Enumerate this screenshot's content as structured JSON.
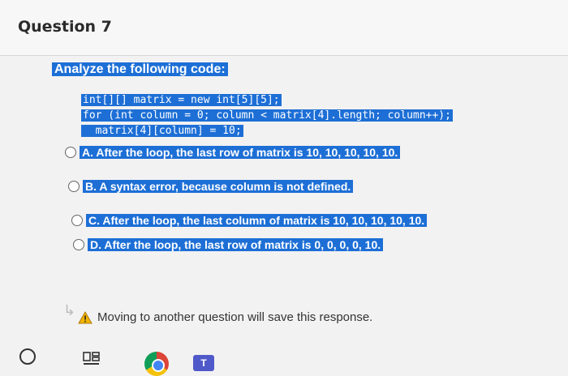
{
  "question": {
    "title": "Question 7"
  },
  "prompt": "Analyze the following code:",
  "code_lines": [
    "int[][] matrix = new int[5][5];",
    "for (int column = 0; column < matrix[4].length; column++);",
    "  matrix[4][column] = 10;"
  ],
  "options": [
    {
      "letter": "A.",
      "text": "After the loop, the last row of matrix is 10, 10, 10, 10, 10."
    },
    {
      "letter": "B.",
      "text": "A syntax error, because column is not defined."
    },
    {
      "letter": "C.",
      "text": "After the loop, the last column of matrix is 10, 10, 10, 10, 10."
    },
    {
      "letter": "D.",
      "text": "After the loop, the last row of matrix is 0, 0, 0, 0, 10."
    }
  ],
  "notice": "Moving to another question will save this response.",
  "colors": {
    "selection": "#1d6fd6",
    "warning": "#f0b400"
  },
  "taskbar": {
    "teams_label": "T"
  }
}
